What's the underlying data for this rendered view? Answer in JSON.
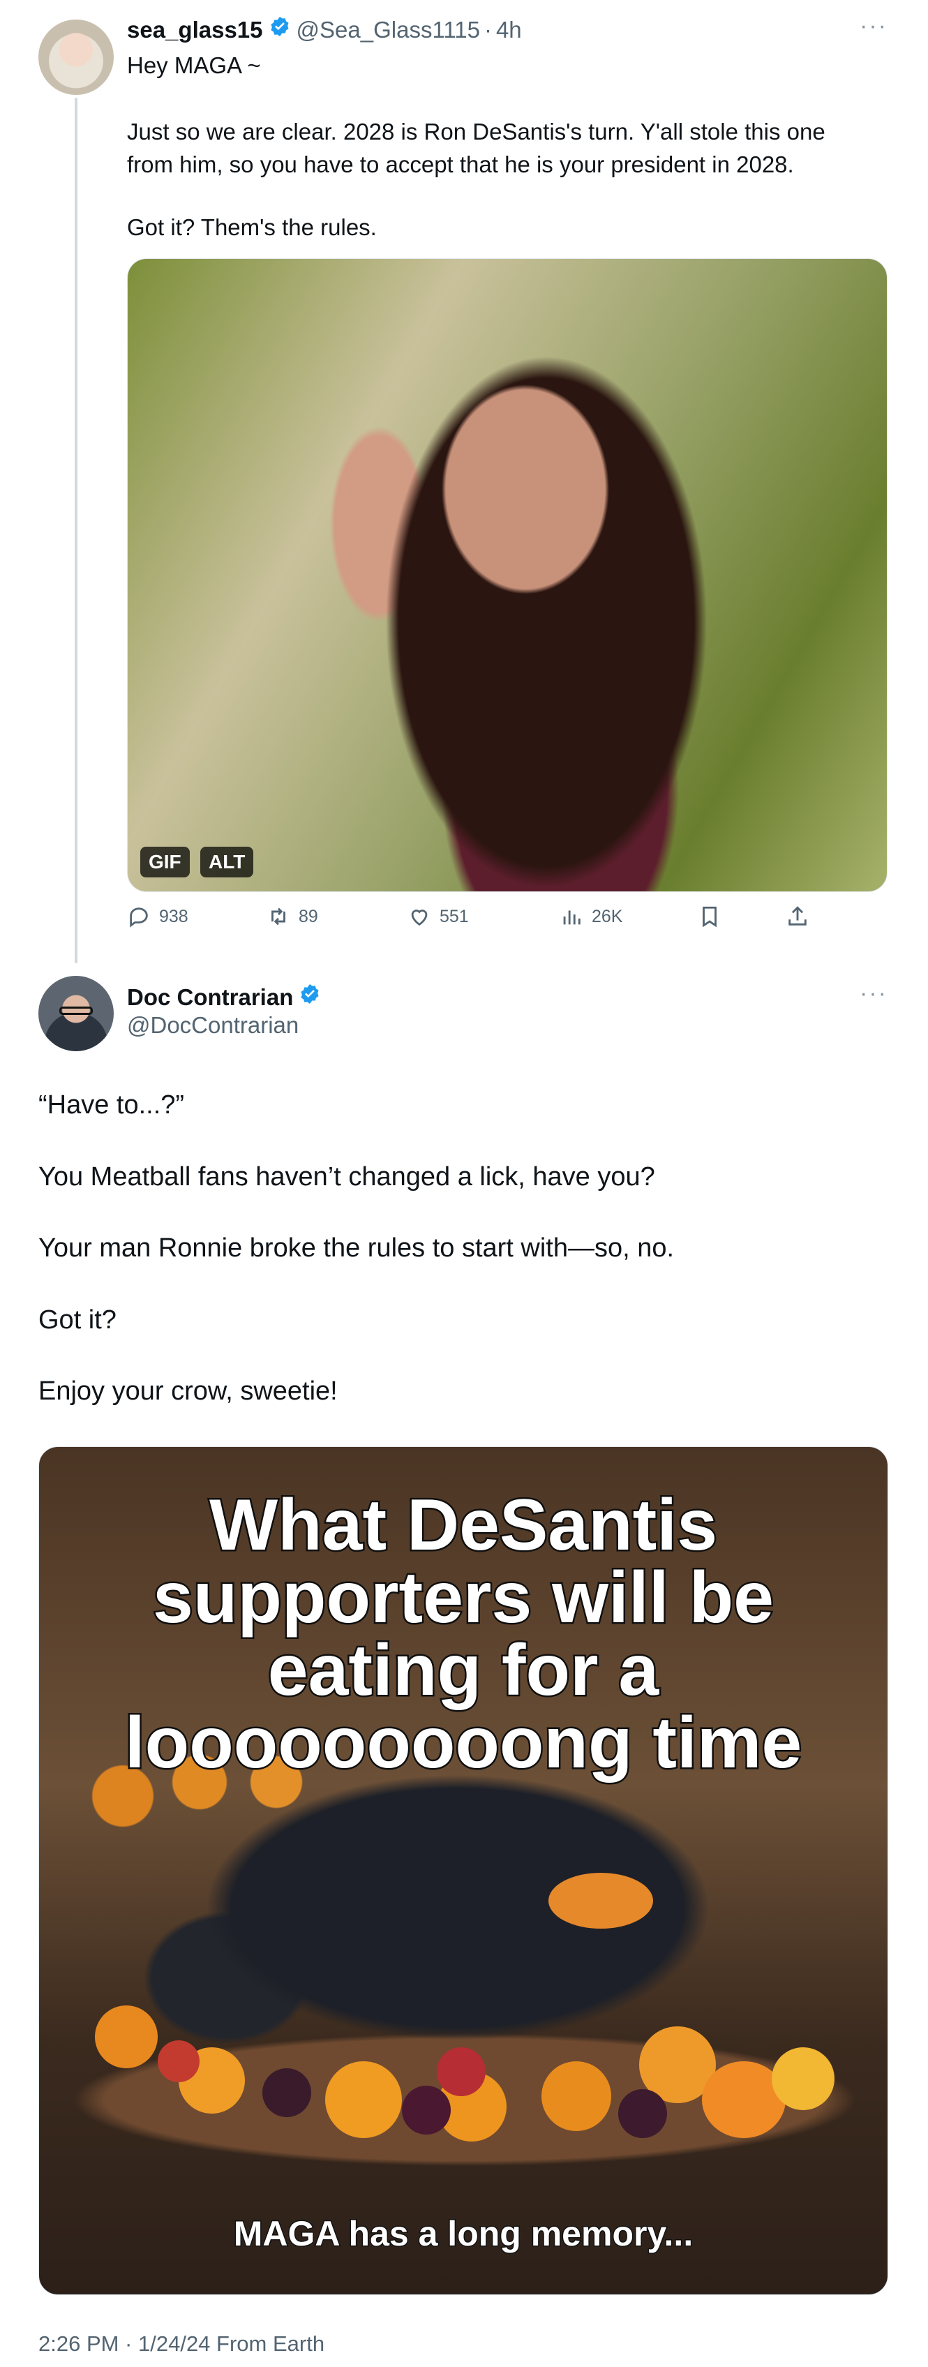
{
  "tweet1": {
    "author_name": "sea_glass15",
    "handle": "@Sea_Glass1115",
    "separator": "·",
    "time": "4h",
    "more": "···",
    "text_lines": [
      "Hey MAGA ~",
      "Just so we are clear. 2028 is Ron DeSantis's turn. Y'all stole this one\nfrom him, so you have to accept that he is your president in 2028.",
      "Got it? Them's the rules."
    ],
    "media": {
      "badge_gif": "GIF",
      "badge_alt": "ALT"
    },
    "actions": {
      "replies": "938",
      "reposts": "89",
      "likes": "551",
      "views": "26K"
    }
  },
  "tweet2": {
    "author_name": "Doc Contrarian",
    "handle": "@DocContrarian",
    "more": "···",
    "paragraphs": [
      "“Have to...?”",
      "You Meatball fans haven’t changed a lick, have you?",
      "Your man Ronnie broke the rules to start with—so, no.",
      "Got it?",
      "Enjoy your crow, sweetie!"
    ],
    "meme": {
      "top_text": "What DeSantis\nsupporters will be\neating for a\nlooooooooong time",
      "bottom_text": "MAGA has a long memory..."
    },
    "footer": "2:26 PM · 1/24/24 From Earth"
  },
  "colors": {
    "verified_blue": "#1d9bf0",
    "secondary_text": "#536471",
    "thread_line": "#cfd9de"
  },
  "icons": [
    "verified-badge-icon",
    "reply-icon",
    "repost-icon",
    "like-icon",
    "views-icon",
    "bookmark-icon",
    "share-icon",
    "more-icon"
  ]
}
